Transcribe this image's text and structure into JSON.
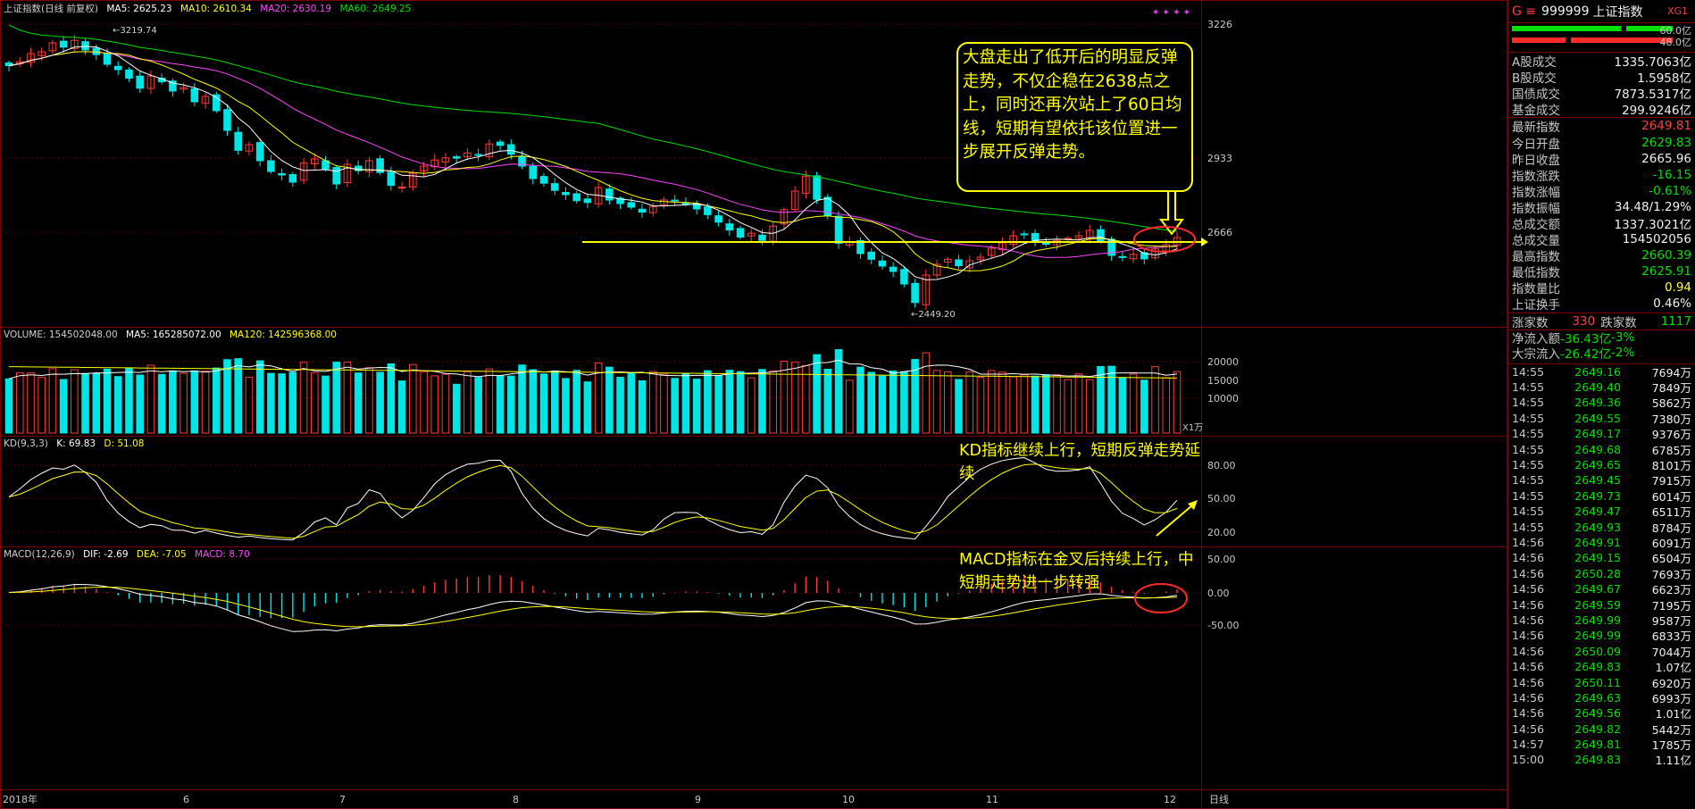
{
  "chart_data": {
    "type": "candlestick",
    "title": "上证指数(日线 前复权)",
    "price_panel": {
      "ma_legend": {
        "ma5": "MA5: 2625.23",
        "ma10": "MA10: 2610.34",
        "ma20": "MA20: 2630.19",
        "ma60": "MA60: 2649.25"
      },
      "ylim": [
        2410,
        3260
      ],
      "y_ticks": [
        "3226",
        "2933",
        "2666"
      ],
      "high_label": "3219.74",
      "low_label": "2449.20",
      "support_level": 2638,
      "closes": [
        3131,
        3142,
        3165,
        3170,
        3195,
        3183,
        3202,
        3175,
        3162,
        3135,
        3120,
        3096,
        3068,
        3102,
        3086,
        3060,
        3070,
        3030,
        3045,
        3005,
        2950,
        2894,
        2910,
        2865,
        2835,
        2825,
        2805,
        2859,
        2870,
        2842,
        2800,
        2855,
        2837,
        2865,
        2832,
        2796,
        2791,
        2830,
        2850,
        2867,
        2873,
        2872,
        2887,
        2880,
        2912,
        2908,
        2883,
        2850,
        2815,
        2802,
        2782,
        2770,
        2753,
        2748,
        2790,
        2755,
        2745,
        2735,
        2721,
        2736,
        2755,
        2753,
        2743,
        2730,
        2714,
        2693,
        2671,
        2651,
        2662,
        2642,
        2682,
        2728,
        2780,
        2822,
        2757,
        2712,
        2634,
        2638,
        2605,
        2589,
        2570,
        2555,
        2520,
        2468,
        2545,
        2575,
        2589,
        2571,
        2585,
        2595,
        2620,
        2635,
        2655,
        2659,
        2640,
        2631,
        2642,
        2648,
        2655,
        2670,
        2640,
        2600,
        2595,
        2603,
        2590,
        2618,
        2630,
        2650
      ]
    },
    "volume_panel": {
      "legend": {
        "volume": "VOLUME: 154502048.00",
        "ma5": "MA5: 165285072.00",
        "ma120": "MA120: 142596368.00"
      },
      "unit": "X1万",
      "y_ticks": [
        "20000",
        "15000",
        "10000"
      ],
      "ylim": [
        0,
        24000
      ]
    },
    "kd_panel": {
      "legend": {
        "name": "KD(9,3,3)",
        "k": "K: 69.83",
        "d": "D: 51.08"
      },
      "y_ticks": [
        "80.00",
        "50.00",
        "20.00"
      ],
      "ylim": [
        0,
        100
      ]
    },
    "macd_panel": {
      "legend": {
        "name": "MACD(12,26,9)",
        "dif": "DIF: -2.69",
        "dea": "DEA: -7.05",
        "macd": "MACD: 8.70"
      },
      "y_ticks": [
        "50.00",
        "0.00",
        "-50.00"
      ],
      "ylim": [
        -75,
        75
      ]
    },
    "x_ticks": [
      "2018年",
      "6",
      "7",
      "8",
      "9",
      "10",
      "11",
      "12"
    ],
    "period_label": "日线",
    "annotations": {
      "main": "大盘走出了低开后的明显反弹走势，不仅企稳在2638点之上，同时还再次站上了60日均线，短期有望依托该位置进一步展开反弹走势。",
      "kd": "KD指标继续上行，短期反弹走势延续",
      "macd": "MACD指标在金叉后持续上行，中短期走势进一步转强"
    },
    "colors": {
      "up": "#ff3b3b",
      "down": "#00e5e5",
      "ma5": "#ffffff",
      "ma10": "#ffff00",
      "ma20": "#ff44ff",
      "ma60": "#00e000",
      "note": "#ffff00",
      "grid": "#7a0000"
    }
  },
  "panel": {
    "header": {
      "code": "999999",
      "name": "上证指数",
      "tag": "XG1"
    },
    "ratio_bars": [
      {
        "label": "60.0亿"
      },
      {
        "label": "48.0亿"
      }
    ],
    "turnover": [
      {
        "label": "A股成交",
        "value": "1335.7063亿"
      },
      {
        "label": "B股成交",
        "value": "1.5958亿"
      },
      {
        "label": "国债成交",
        "value": "7873.5317亿"
      },
      {
        "label": "基金成交",
        "value": "299.9246亿"
      }
    ],
    "quote": [
      {
        "label": "最新指数",
        "value": "2649.81",
        "cls": "up"
      },
      {
        "label": "今日开盘",
        "value": "2629.83",
        "cls": "down"
      },
      {
        "label": "昨日收盘",
        "value": "2665.96",
        "cls": "white"
      },
      {
        "label": "指数涨跌",
        "value": "-16.15",
        "cls": "down"
      },
      {
        "label": "指数涨幅",
        "value": "-0.61%",
        "cls": "down"
      },
      {
        "label": "指数振幅",
        "value": "34.48/1.29%",
        "cls": "white"
      },
      {
        "label": "总成交额",
        "value": "1337.3021亿",
        "cls": "white"
      },
      {
        "label": "总成交量",
        "value": "154502056",
        "cls": "white"
      },
      {
        "label": "最高指数",
        "value": "2660.39",
        "cls": "down"
      },
      {
        "label": "最低指数",
        "value": "2625.91",
        "cls": "down"
      },
      {
        "label": "指数量比",
        "value": "0.94",
        "cls": "yel"
      },
      {
        "label": "上证换手",
        "value": "0.46%",
        "cls": "white"
      }
    ],
    "breadth": {
      "up_label": "涨家数",
      "up_value": "330",
      "down_label": "跌家数",
      "down_value": "1117"
    },
    "flows": [
      {
        "label": "净流入额",
        "value": "-36.43亿",
        "pct": "-3%"
      },
      {
        "label": "大宗流入",
        "value": "-26.42亿",
        "pct": "-2%"
      }
    ],
    "ticks": [
      {
        "t": "14:55",
        "p": "2649.16",
        "v": "7694万"
      },
      {
        "t": "14:55",
        "p": "2649.40",
        "v": "7849万"
      },
      {
        "t": "14:55",
        "p": "2649.36",
        "v": "5862万"
      },
      {
        "t": "14:55",
        "p": "2649.55",
        "v": "7380万"
      },
      {
        "t": "14:55",
        "p": "2649.17",
        "v": "9376万"
      },
      {
        "t": "14:55",
        "p": "2649.68",
        "v": "6785万"
      },
      {
        "t": "14:55",
        "p": "2649.65",
        "v": "8101万"
      },
      {
        "t": "14:55",
        "p": "2649.45",
        "v": "7915万"
      },
      {
        "t": "14:55",
        "p": "2649.73",
        "v": "6014万"
      },
      {
        "t": "14:55",
        "p": "2649.47",
        "v": "6511万"
      },
      {
        "t": "14:55",
        "p": "2649.93",
        "v": "8784万"
      },
      {
        "t": "14:56",
        "p": "2649.91",
        "v": "6091万"
      },
      {
        "t": "14:56",
        "p": "2649.15",
        "v": "6504万"
      },
      {
        "t": "14:56",
        "p": "2650.28",
        "v": "7693万"
      },
      {
        "t": "14:56",
        "p": "2649.67",
        "v": "6623万"
      },
      {
        "t": "14:56",
        "p": "2649.59",
        "v": "7195万"
      },
      {
        "t": "14:56",
        "p": "2649.99",
        "v": "9587万"
      },
      {
        "t": "14:56",
        "p": "2649.99",
        "v": "6833万"
      },
      {
        "t": "14:56",
        "p": "2650.09",
        "v": "7044万"
      },
      {
        "t": "14:56",
        "p": "2649.83",
        "v": "1.07亿"
      },
      {
        "t": "14:56",
        "p": "2650.11",
        "v": "6920万"
      },
      {
        "t": "14:56",
        "p": "2649.63",
        "v": "6993万"
      },
      {
        "t": "14:56",
        "p": "2649.56",
        "v": "1.01亿"
      },
      {
        "t": "14:56",
        "p": "2649.82",
        "v": "5442万"
      },
      {
        "t": "14:57",
        "p": "2649.81",
        "v": "1785万"
      },
      {
        "t": "15:00",
        "p": "2649.83",
        "v": "1.11亿"
      }
    ]
  }
}
